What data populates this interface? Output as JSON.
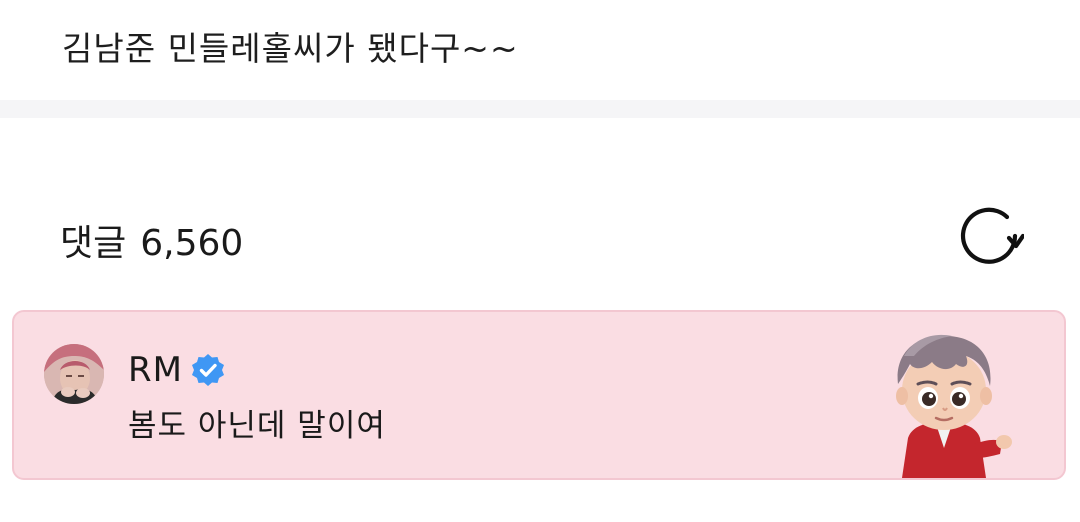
{
  "post": {
    "text": "김남준 민들레홀씨가 됐다구~~"
  },
  "comments": {
    "label": "댓글",
    "count": "6,560"
  },
  "top_comment": {
    "author": "RM",
    "text": "봄도 아닌데 말이여"
  },
  "colors": {
    "card_bg": "#fadde3",
    "card_border": "#f3c7d1",
    "verified_badge": "#3f97f4"
  },
  "icons": [
    "refresh-icon",
    "verified-badge-icon"
  ]
}
